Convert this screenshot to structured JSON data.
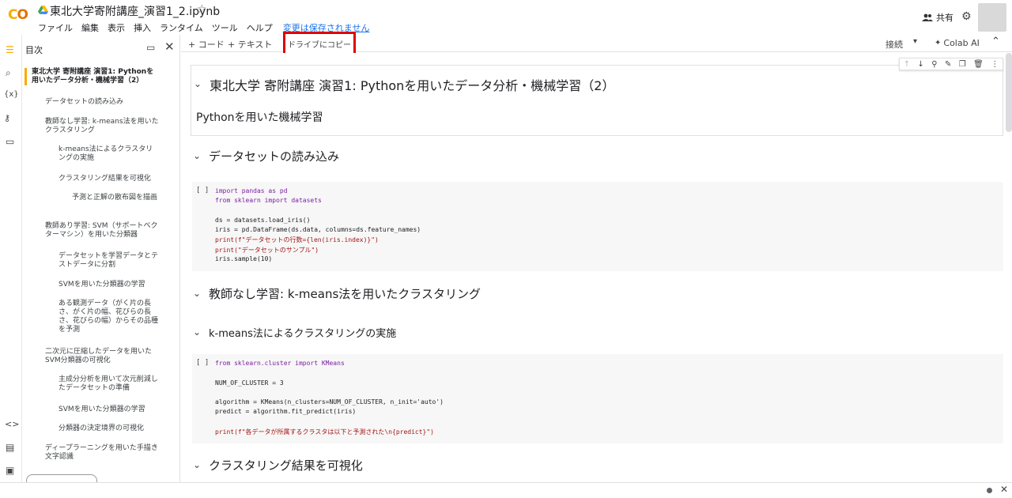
{
  "header": {
    "logo": [
      "C",
      "O"
    ],
    "filename": "東北大学寄附講座_演習1_2.ipynb",
    "star": "☆",
    "menus": [
      "ファイル",
      "編集",
      "表示",
      "挿入",
      "ランタイム",
      "ツール",
      "ヘルプ"
    ],
    "unsaved_notice": "変更は保存されません",
    "share_label": "共有"
  },
  "toolbar": {
    "add_code": "+ コード",
    "add_text": "+ テキスト",
    "copy_to_drive": "ドライブにコピー",
    "connect": "接続",
    "colab_ai": "Colab AI"
  },
  "sidebar": {
    "title": "目次",
    "toc": [
      "東北大学 寄附講座 演習1: Pythonを用いたデータ分析・機械学習（2）",
      "データセットの読み込み",
      "教師なし学習: k-means法を用いたクラスタリング",
      "k-means法によるクラスタリングの実施",
      "クラスタリング結果を可視化",
      "予測と正解の散布図を描画",
      "教師あり学習: SVM（サポートベクターマシン）を用いた分類器",
      "データセットを学習データとテストデータに分割",
      "SVMを用いた分類器の学習",
      "ある観測データ（がく片の長さ、がく片の幅、花びらの長さ、花びらの幅）からその品種を予測",
      "二次元に圧縮したデータを用いたSVM分類器の可視化",
      "主成分分析を用いて次元削減したデータセットの準備",
      "SVMを用いた分類器の学習",
      "分類器の決定境界の可視化",
      "ディープラーニングを用いた手描き文字認識"
    ]
  },
  "notebook": {
    "title": "東北大学 寄附講座 演習1: Pythonを用いたデータ分析・機械学習（2）",
    "subtitle": "Pythonを用いた機械学習",
    "h_dataset": "データセットの読み込み",
    "code1_run": "[ ]",
    "code1": [
      "import pandas as pd",
      "from sklearn import datasets",
      "",
      "ds = datasets.load_iris()",
      "iris = pd.DataFrame(ds.data, columns=ds.feature_names)",
      "print(f\"データセットの行数={len(iris.index)}\")",
      "print(\"データセットのサンプル\")",
      "iris.sample(10)"
    ],
    "h_unsupervised": "教師なし学習: k-means法を用いたクラスタリング",
    "h_kmeans": "k-means法によるクラスタリングの実施",
    "code2_run": "[ ]",
    "code2": [
      "from sklearn.cluster import KMeans",
      "",
      "NUM_OF_CLUSTER = 3",
      "",
      "algorithm = KMeans(n_clusters=NUM_OF_CLUSTER, n_init='auto')",
      "predict = algorithm.fit_predict(iris)",
      "",
      "print(f\"各データが所属するクラスタは以下と予測された\\n{predict}\")"
    ],
    "h_visualize": "クラスタリング結果を可視化"
  }
}
